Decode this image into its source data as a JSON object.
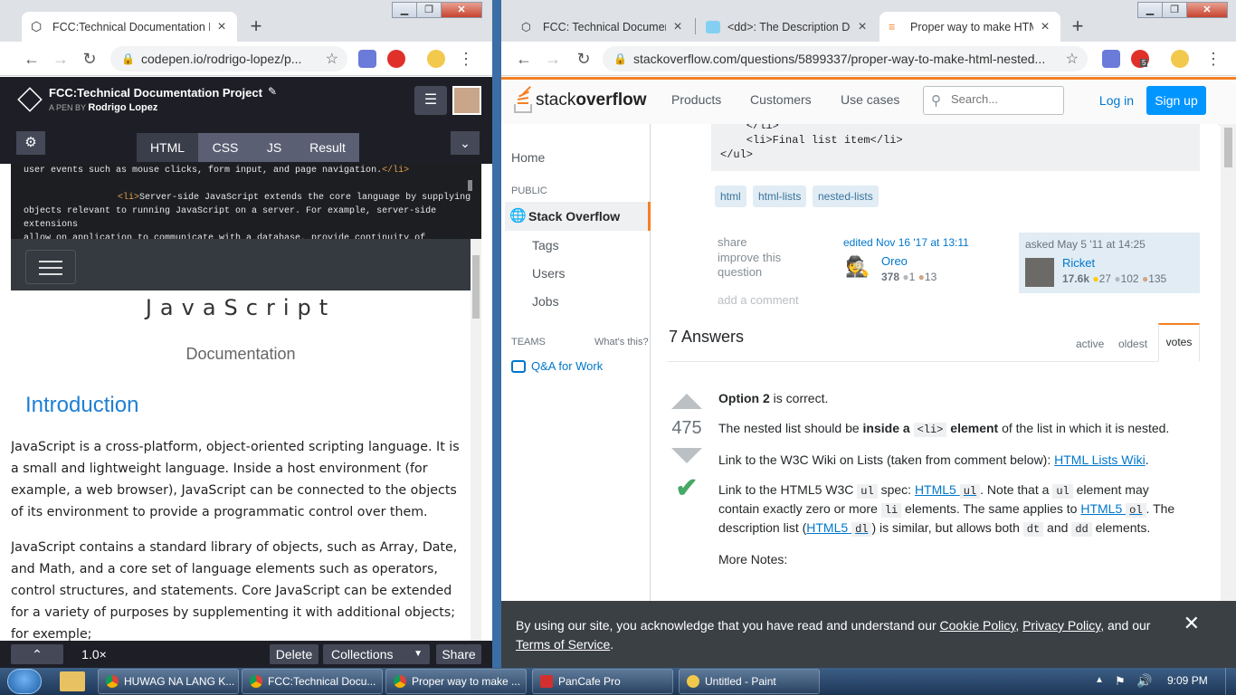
{
  "left_window": {
    "tab_title": "FCC:Technical Documentation Pr",
    "url": "codepen.io/rodrigo-lopez/p...",
    "pen_title": "FCC:Technical Documentation Project",
    "pen_by_label": "A PEN BY",
    "pen_author": "Rodrigo Lopez",
    "editor_tabs": [
      "HTML",
      "CSS",
      "JS",
      "Result"
    ],
    "code_lines": [
      "user events such as mouse clicks, form input, and page navigation.",
      "",
      "Server-side JavaScript extends the core language by supplying",
      "objects relevant to running JavaScript on a server. For example, server-side extensions",
      "allow on application to communicate with a database, provide continuity of information"
    ],
    "code_tag_close": "</li>",
    "code_tag_open": "<li>",
    "result": {
      "heading": "JavaScript",
      "subheading": "Documentation",
      "section_title": "Introduction",
      "paragraphs": [
        "JavaScript is a cross-platform, object-oriented scripting language. It is a small and lightweight language. Inside a host environment (for example, a web browser), JavaScript can be connected to the objects of its environment to provide a programmatic control over them.",
        "JavaScript contains a standard library of objects, such as Array, Date, and Math, and a core set of language elements such as operators, control structures, and statements. Core JavaScript can be extended for a variety of purposes by supplementing it with additional objects; for exemple;"
      ]
    },
    "footer": {
      "zoom": "1.0×",
      "delete": "Delete",
      "collections": "Collections",
      "share": "Share"
    }
  },
  "right_window": {
    "tabs": [
      {
        "title": "FCC: Technical Document"
      },
      {
        "title": "<dd>: The Description De"
      },
      {
        "title": "Proper way to make HTM"
      }
    ],
    "url": "stackoverflow.com/questions/5899337/proper-way-to-make-html-nested...",
    "ext_badge": "5",
    "header": {
      "logo_light": "stack",
      "logo_bold": "overflow",
      "nav": [
        "Products",
        "Customers",
        "Use cases"
      ],
      "search_placeholder": "Search...",
      "login": "Log in",
      "signup": "Sign up"
    },
    "sidebar": {
      "home": "Home",
      "public_label": "PUBLIC",
      "stack_overflow": "Stack Overflow",
      "items": [
        "Tags",
        "Users",
        "Jobs"
      ],
      "teams_label": "TEAMS",
      "whats_this": "What's this?",
      "qa_for_work": "Q&A for Work"
    },
    "question": {
      "code_lines": [
        "    </li>",
        "    <li>Final list item</li>",
        "</ul>"
      ],
      "tags": [
        "html",
        "html-lists",
        "nested-lists"
      ],
      "actions": [
        "share",
        "improve this question",
        "add a comment"
      ],
      "editor": {
        "label": "edited Nov 16 '17 at 13:11",
        "name": "Oreo",
        "rep": "378",
        "silver": "1",
        "bronze": "13"
      },
      "asker": {
        "label": "asked May 5 '11 at 14:25",
        "name": "Ricket",
        "rep": "17.6k",
        "gold": "27",
        "silver": "102",
        "bronze": "135"
      }
    },
    "answers": {
      "count_label": "7 Answers",
      "sort_tabs": [
        "active",
        "oldest",
        "votes"
      ],
      "votes": "475",
      "p1_bold": "Option 2",
      "p1_rest": " is correct.",
      "p2_a": "The nested list should be ",
      "p2_bold1": "inside a",
      "p2_code": "<li>",
      "p2_bold2": "element",
      "p2_b": " of the list in which it is nested.",
      "p3_a": "Link to the W3C Wiki on Lists (taken from comment below): ",
      "p3_link": "HTML Lists Wiki",
      "p3_b": ".",
      "p4_a": "Link to the HTML5 W3C ",
      "p4_code1": "ul",
      "p4_b": " spec: ",
      "p4_link1": "HTML5",
      "p4_c": ". Note that a ",
      "p4_d": " element may contain exactly zero or more ",
      "p4_code2": "li",
      "p4_e": " elements. The same applies to ",
      "p4_link2": "HTML5",
      "p4_code3": "ol",
      "p4_f": ". The description list (",
      "p4_code4": "dl",
      "p4_g": ") is similar, but allows both ",
      "p4_code5": "dt",
      "p4_h": " and ",
      "p4_code6": "dd",
      "p4_i": " elements.",
      "p5": "More Notes:"
    },
    "cookie": {
      "text_a": "By using our site, you acknowledge that you have read and understand our ",
      "cookie_policy": "Cookie Policy",
      "sep": ", ",
      "privacy_policy": "Privacy Policy",
      "and_our": ", and our ",
      "terms": "Terms of Service",
      "end": "."
    }
  },
  "taskbar": {
    "items": [
      "HUWAG NA LANG K...",
      "FCC:Technical Docu...",
      "Proper way to make ...",
      "PanCafe Pro",
      "Untitled - Paint"
    ],
    "time": "9:09 PM"
  },
  "colors": {
    "so_orange": "#f48024",
    "so_blue": "#0095ff",
    "link_blue": "#0077cc",
    "codepen_dark": "#1e1f26",
    "accept_green": "#48a868"
  }
}
